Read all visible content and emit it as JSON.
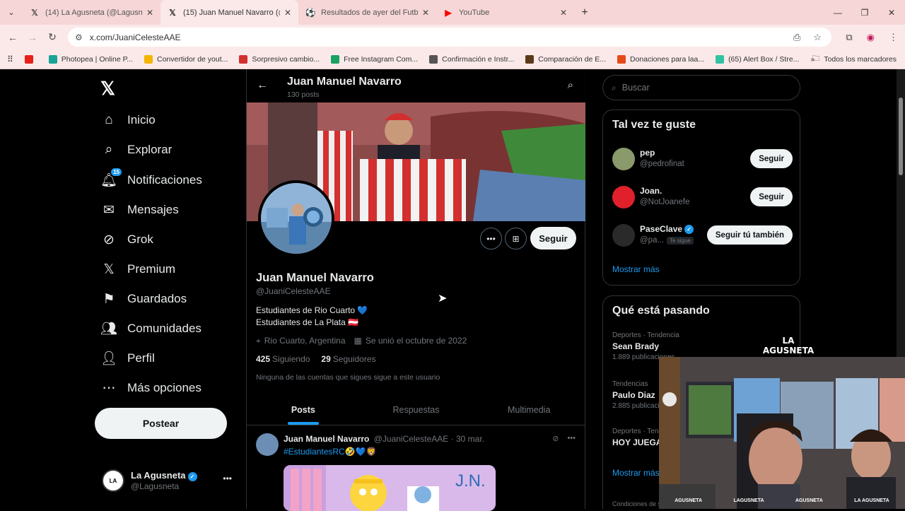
{
  "browser": {
    "tabs": [
      {
        "title": "(14) La Agusneta (@Lagusneta) / X",
        "icon": "x-icon"
      },
      {
        "title": "(15) Juan Manuel Navarro (@Ju...",
        "icon": "x-icon"
      },
      {
        "title": "Resultados de ayer del Futbol A...",
        "icon": "soccer-icon"
      },
      {
        "title": "YouTube",
        "icon": "youtube-icon"
      }
    ],
    "url": "x.com/JuaniCelesteAAE",
    "bookmarks": [
      {
        "label": "",
        "color": "#e62117"
      },
      {
        "label": "Photopea | Online P...",
        "color": "#18a497"
      },
      {
        "label": "Convertidor de yout...",
        "color": "#f4b400"
      },
      {
        "label": "Sorpresivo cambio...",
        "color": "#d32f2f"
      },
      {
        "label": "Free Instagram Com...",
        "color": "#1aa260"
      },
      {
        "label": "Confirmación e Instr...",
        "color": "#555555"
      },
      {
        "label": "Comparación de E...",
        "color": "#5b3a1a"
      },
      {
        "label": "Donaciones para laa...",
        "color": "#e64a19"
      },
      {
        "label": "(65) Alert Box / Stre...",
        "color": "#31c3a2"
      }
    ],
    "bookmarks_all": "Todos los marcadores"
  },
  "sidebar": {
    "items": [
      {
        "label": "Inicio",
        "icon": "home-icon"
      },
      {
        "label": "Explorar",
        "icon": "search-icon"
      },
      {
        "label": "Notificaciones",
        "icon": "bell-icon",
        "badge": "15"
      },
      {
        "label": "Mensajes",
        "icon": "mail-icon"
      },
      {
        "label": "Grok",
        "icon": "grok-icon"
      },
      {
        "label": "Premium",
        "icon": "x-icon"
      },
      {
        "label": "Guardados",
        "icon": "bookmark-icon"
      },
      {
        "label": "Comunidades",
        "icon": "communities-icon"
      },
      {
        "label": "Perfil",
        "icon": "user-icon"
      },
      {
        "label": "Más opciones",
        "icon": "more-circle-icon"
      }
    ],
    "post_label": "Postear",
    "account": {
      "name": "La Agusneta",
      "handle": "@Lagusneta"
    }
  },
  "profile": {
    "header_name": "Juan Manuel Navarro",
    "header_posts": "130 posts",
    "name": "Juan Manuel Navarro",
    "handle": "@JuaniCelesteAAE",
    "bio_line1": "Estudiantes de Rio Cuarto 💙",
    "bio_line2": "Estudiantes de La Plata 🇦🇹",
    "location": "Rio Cuarto, Argentina",
    "joined": "Se unió el octubre de 2022",
    "following_count": "425",
    "following_label": "Siguiendo",
    "followers_count": "29",
    "followers_label": "Seguidores",
    "known_followers": "Ninguna de las cuentas que sigues sigue a este usuario",
    "follow_label": "Seguir",
    "tabs": [
      "Posts",
      "Respuestas",
      "Multimedia"
    ]
  },
  "tweet": {
    "name": "Juan Manuel Navarro",
    "handle": "@JuaniCelesteAAE",
    "date": "· 30 mar.",
    "hashtag": "#EstudiantesRC",
    "emoji": "🤣💙🦁",
    "image_text": "J.N."
  },
  "right": {
    "search_placeholder": "Buscar",
    "suggestions_title": "Tal vez te guste",
    "suggestions": [
      {
        "name": "pep",
        "handle": "@pedrofinat",
        "button": "Seguir",
        "color": "#8a9a6a"
      },
      {
        "name": "Joan.",
        "handle": "@NotJoanefe",
        "button": "Seguir",
        "color": "#e0202a"
      },
      {
        "name": "PaseClave",
        "handle": "@pa...",
        "button": "Seguir tú también",
        "follows_you": "Te sigue",
        "color": "#2a2a2a"
      }
    ],
    "show_more": "Mostrar más",
    "trends_title": "Qué está pasando",
    "trends": [
      {
        "category": "Deportes · Tendencia",
        "name": "Sean Brady",
        "posts": "1.889 publicaciones"
      },
      {
        "category": "Tendencias",
        "name": "Paulo Diaz",
        "posts": "2.885 publicaciones"
      },
      {
        "category": "Deportes · Tendencia",
        "name": "HOY JUEGA",
        "posts": ""
      }
    ],
    "footer": "Condiciones de servicio"
  },
  "overlay": {
    "logo_text": "LA AGUSNETA",
    "footer_items": [
      "AGUSNETA",
      "LAGUSNETA",
      "AGUSNETA",
      "LA AGUSNETA"
    ]
  }
}
